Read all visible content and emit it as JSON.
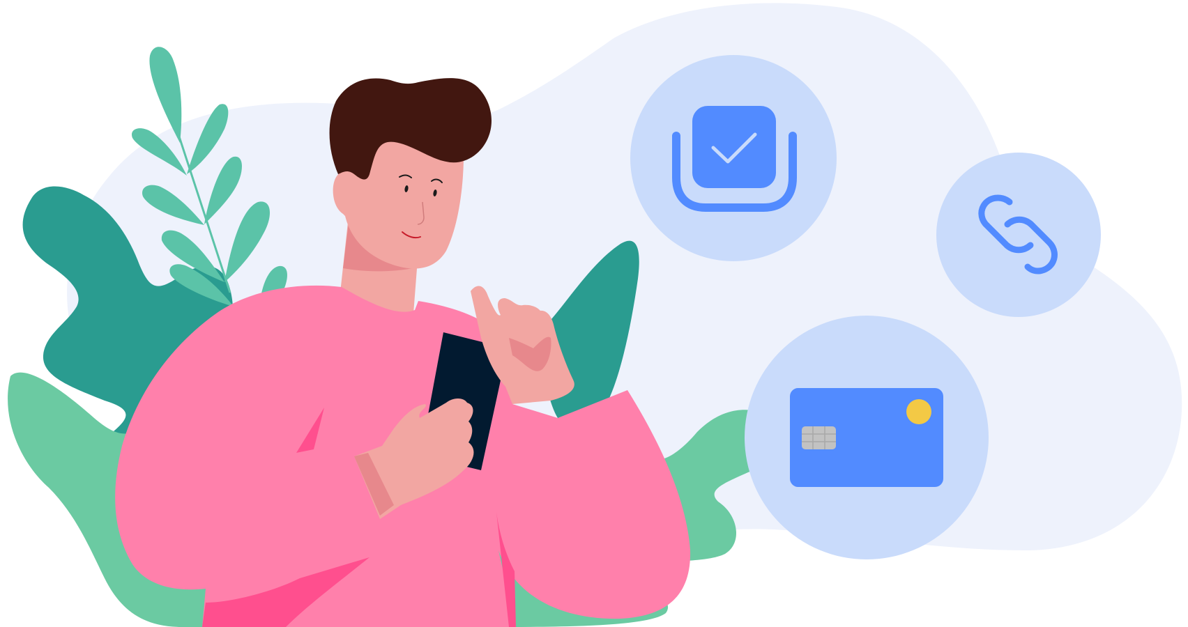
{
  "scene": {
    "subject": "person-using-phone",
    "icons": [
      "checklist-icon",
      "link-icon",
      "credit-card-icon"
    ]
  },
  "colors": {
    "background_blob": "#EEF2FC",
    "icon_circle": "#C9DBFB",
    "accent_blue": "#528BFF",
    "shirt_pink": "#FF80AB",
    "shirt_shadow": "#FF4F8E",
    "skin": "#F2A6A2",
    "skin_shadow": "#E7888C",
    "hair": "#421710",
    "leaf_dark": "#2A9C90",
    "leaf_mid": "#5BC3A8",
    "leaf_light": "#6BCAA2",
    "phone": "#021A30",
    "chip_gold": "#F3C945",
    "chip_silver": "#C2C2C2"
  }
}
